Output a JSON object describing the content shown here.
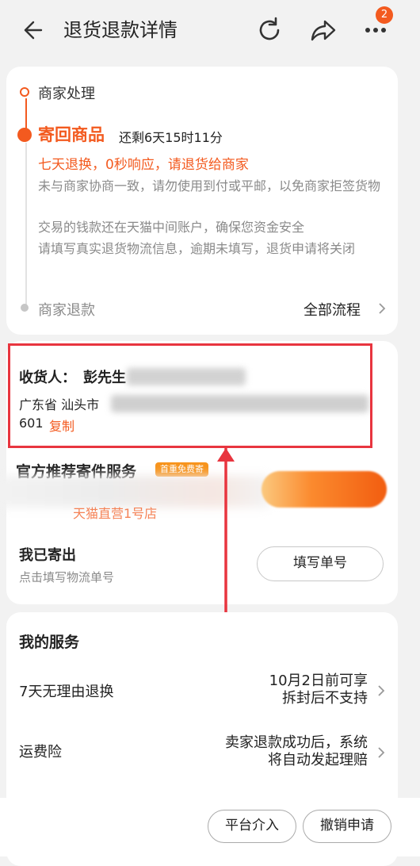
{
  "header": {
    "title": "退货退款详情",
    "badge_count": "2",
    "icons": [
      "back-arrow-icon",
      "refresh-icon",
      "share-icon",
      "more-icon"
    ]
  },
  "progress": {
    "step_done": "商家处理",
    "step_current": "寄回商品",
    "remaining": "还剩6天15时11分",
    "promo": "七天退换，0秒响应，请退货给商家",
    "notes": [
      "未与商家协商一致，请勿使用到付或平邮，以免商家拒签货物",
      "交易的钱款还在天猫中间账户，确保您资金安全",
      "请填写真实退货物流信息，逾期未填写，退货申请将关闭"
    ],
    "step_next": "商家退款",
    "all_flow": "全部流程"
  },
  "address": {
    "recipient_label": "收货人：",
    "recipient_name": "彭先生",
    "line1": "广东省 汕头市",
    "line2": "601",
    "copy": "复制"
  },
  "shipping": {
    "recommend_title": "官方推荐寄件服务",
    "tag": "首重免费寄",
    "store_text": "天猫直营1号店",
    "sent_title": "我已寄出",
    "sent_sub": "点击填写物流单号",
    "fill_button": "填写单号"
  },
  "services": {
    "title": "我的服务",
    "rows": [
      {
        "label": "7天无理由退换",
        "value_line1": "10月2日前可享",
        "value_line2": "拆封后不支持"
      },
      {
        "label": "运费险",
        "value_line1": "卖家退款成功后，系统",
        "value_line2": "将自动发起理赔"
      }
    ]
  },
  "bottom_bar": {
    "platform": "平台介入",
    "cancel": "撤销申请"
  },
  "colors": {
    "accent": "#f35a1f",
    "highlight_frame": "#e8353f",
    "background": "#f2f2f2"
  }
}
